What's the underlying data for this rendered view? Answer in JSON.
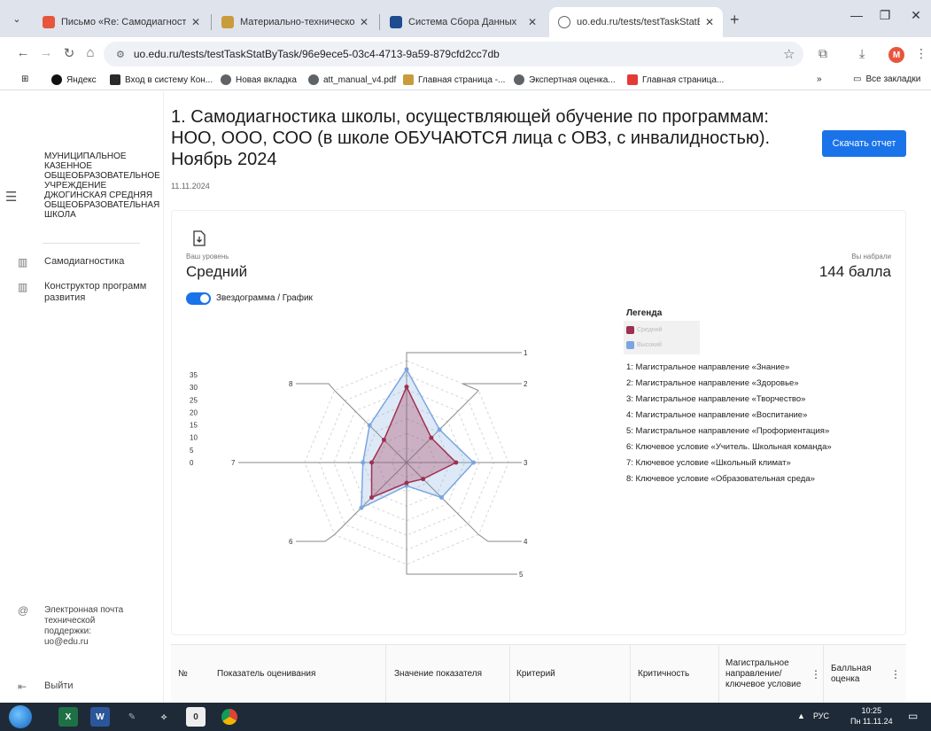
{
  "browser": {
    "tabs": [
      {
        "label": "Письмо «Re: Самодиагностика",
        "favicon_color": "#e8553d"
      },
      {
        "label": "Материально-техническое об",
        "favicon_color": "#c89b3c"
      },
      {
        "label": "Система Сбора Данных",
        "favicon_color": "#1f4b8f"
      },
      {
        "label": "uo.edu.ru/tests/testTaskStatByT",
        "favicon_color": "#5f6368"
      }
    ],
    "new_tab": "+",
    "url": "uo.edu.ru/tests/testTaskStatByTask/96e9ece5-03c4-4713-9a59-879cfd2cc7db",
    "avatar_letter": "M",
    "bookmarks": [
      "Яндекс",
      "Вход в систему Кон...",
      "Новая вкладка",
      "att_manual_v4.pdf",
      "Главная страница -...",
      "Экспертная оценка...",
      "Главная страница..."
    ],
    "bookmarks_more": "»",
    "all_bookmarks": "Все закладки"
  },
  "sidebar": {
    "org_name": "МУНИЦИПАЛЬНОЕ КАЗЕННОЕ ОБЩЕОБРАЗОВАТЕЛЬНОЕ УЧРЕЖДЕНИЕ ДЖОГИНСКАЯ СРЕДНЯЯ ОБЩЕОБРАЗОВАТЕЛЬНАЯ ШКОЛА",
    "items": [
      {
        "label": "Самодиагностика"
      },
      {
        "label": "Конструктор программ развития"
      }
    ],
    "support_label": "Электронная почта технической поддержки:",
    "support_email": "uo@edu.ru",
    "logout_label": "Выйти"
  },
  "main": {
    "title": "1. Самодиагностика школы, осуществляющей обучение по программам: НОО, ООО, СОО (в школе ОБУЧАЮТСЯ лица с ОВЗ, с инвалидностью). Ноябрь 2024",
    "date": "11.11.2024",
    "download_label": "Скачать отчет",
    "level_label": "Ваш уровень",
    "level_value": "Средний",
    "score_label": "Вы набрали",
    "score_value": "144 балла",
    "toggle_label": "Звездограмма / График",
    "toggle_on": true
  },
  "legend": {
    "title": "Легенда",
    "series": [
      {
        "name": "Средний",
        "color": "#a0304f"
      },
      {
        "name": "Высокий",
        "color": "#7aa6e0"
      }
    ],
    "items": [
      "1: Магистральное направление «Знание»",
      "2: Магистральное направление «Здоровье»",
      "3: Магистральное направление «Творчество»",
      "4: Магистральное направление «Воспитание»",
      "5: Магистральное направление «Профориентация»",
      "6: Ключевое условие «Учитель. Школьная команда»",
      "7: Ключевое условие «Школьный климат»",
      "8: Ключевое условие «Образовательная среда»"
    ]
  },
  "chart_data": {
    "type": "radar",
    "categories": [
      "1",
      "2",
      "3",
      "4",
      "5",
      "6",
      "7",
      "8"
    ],
    "axis_ticks": [
      0,
      5,
      10,
      15,
      20,
      25,
      30,
      35
    ],
    "ylim": [
      0,
      35
    ],
    "series": [
      {
        "name": "Средний",
        "color": "#a0304f",
        "values": [
          26,
          12,
          17,
          8,
          7,
          17,
          12,
          11
        ]
      },
      {
        "name": "Высокий",
        "color": "#7aa6e0",
        "values": [
          32,
          16,
          23,
          17,
          8,
          22,
          15,
          18
        ]
      }
    ]
  },
  "table": {
    "headers": [
      "№",
      "Показатель оценивания",
      "Значение показателя",
      "Критерий",
      "Критичность",
      "Магистральное направление/ ключевое условие",
      "Балльная оценка"
    ]
  },
  "taskbar": {
    "lang": "РУС",
    "time": "10:25",
    "date": "Пн 11.11.24"
  }
}
